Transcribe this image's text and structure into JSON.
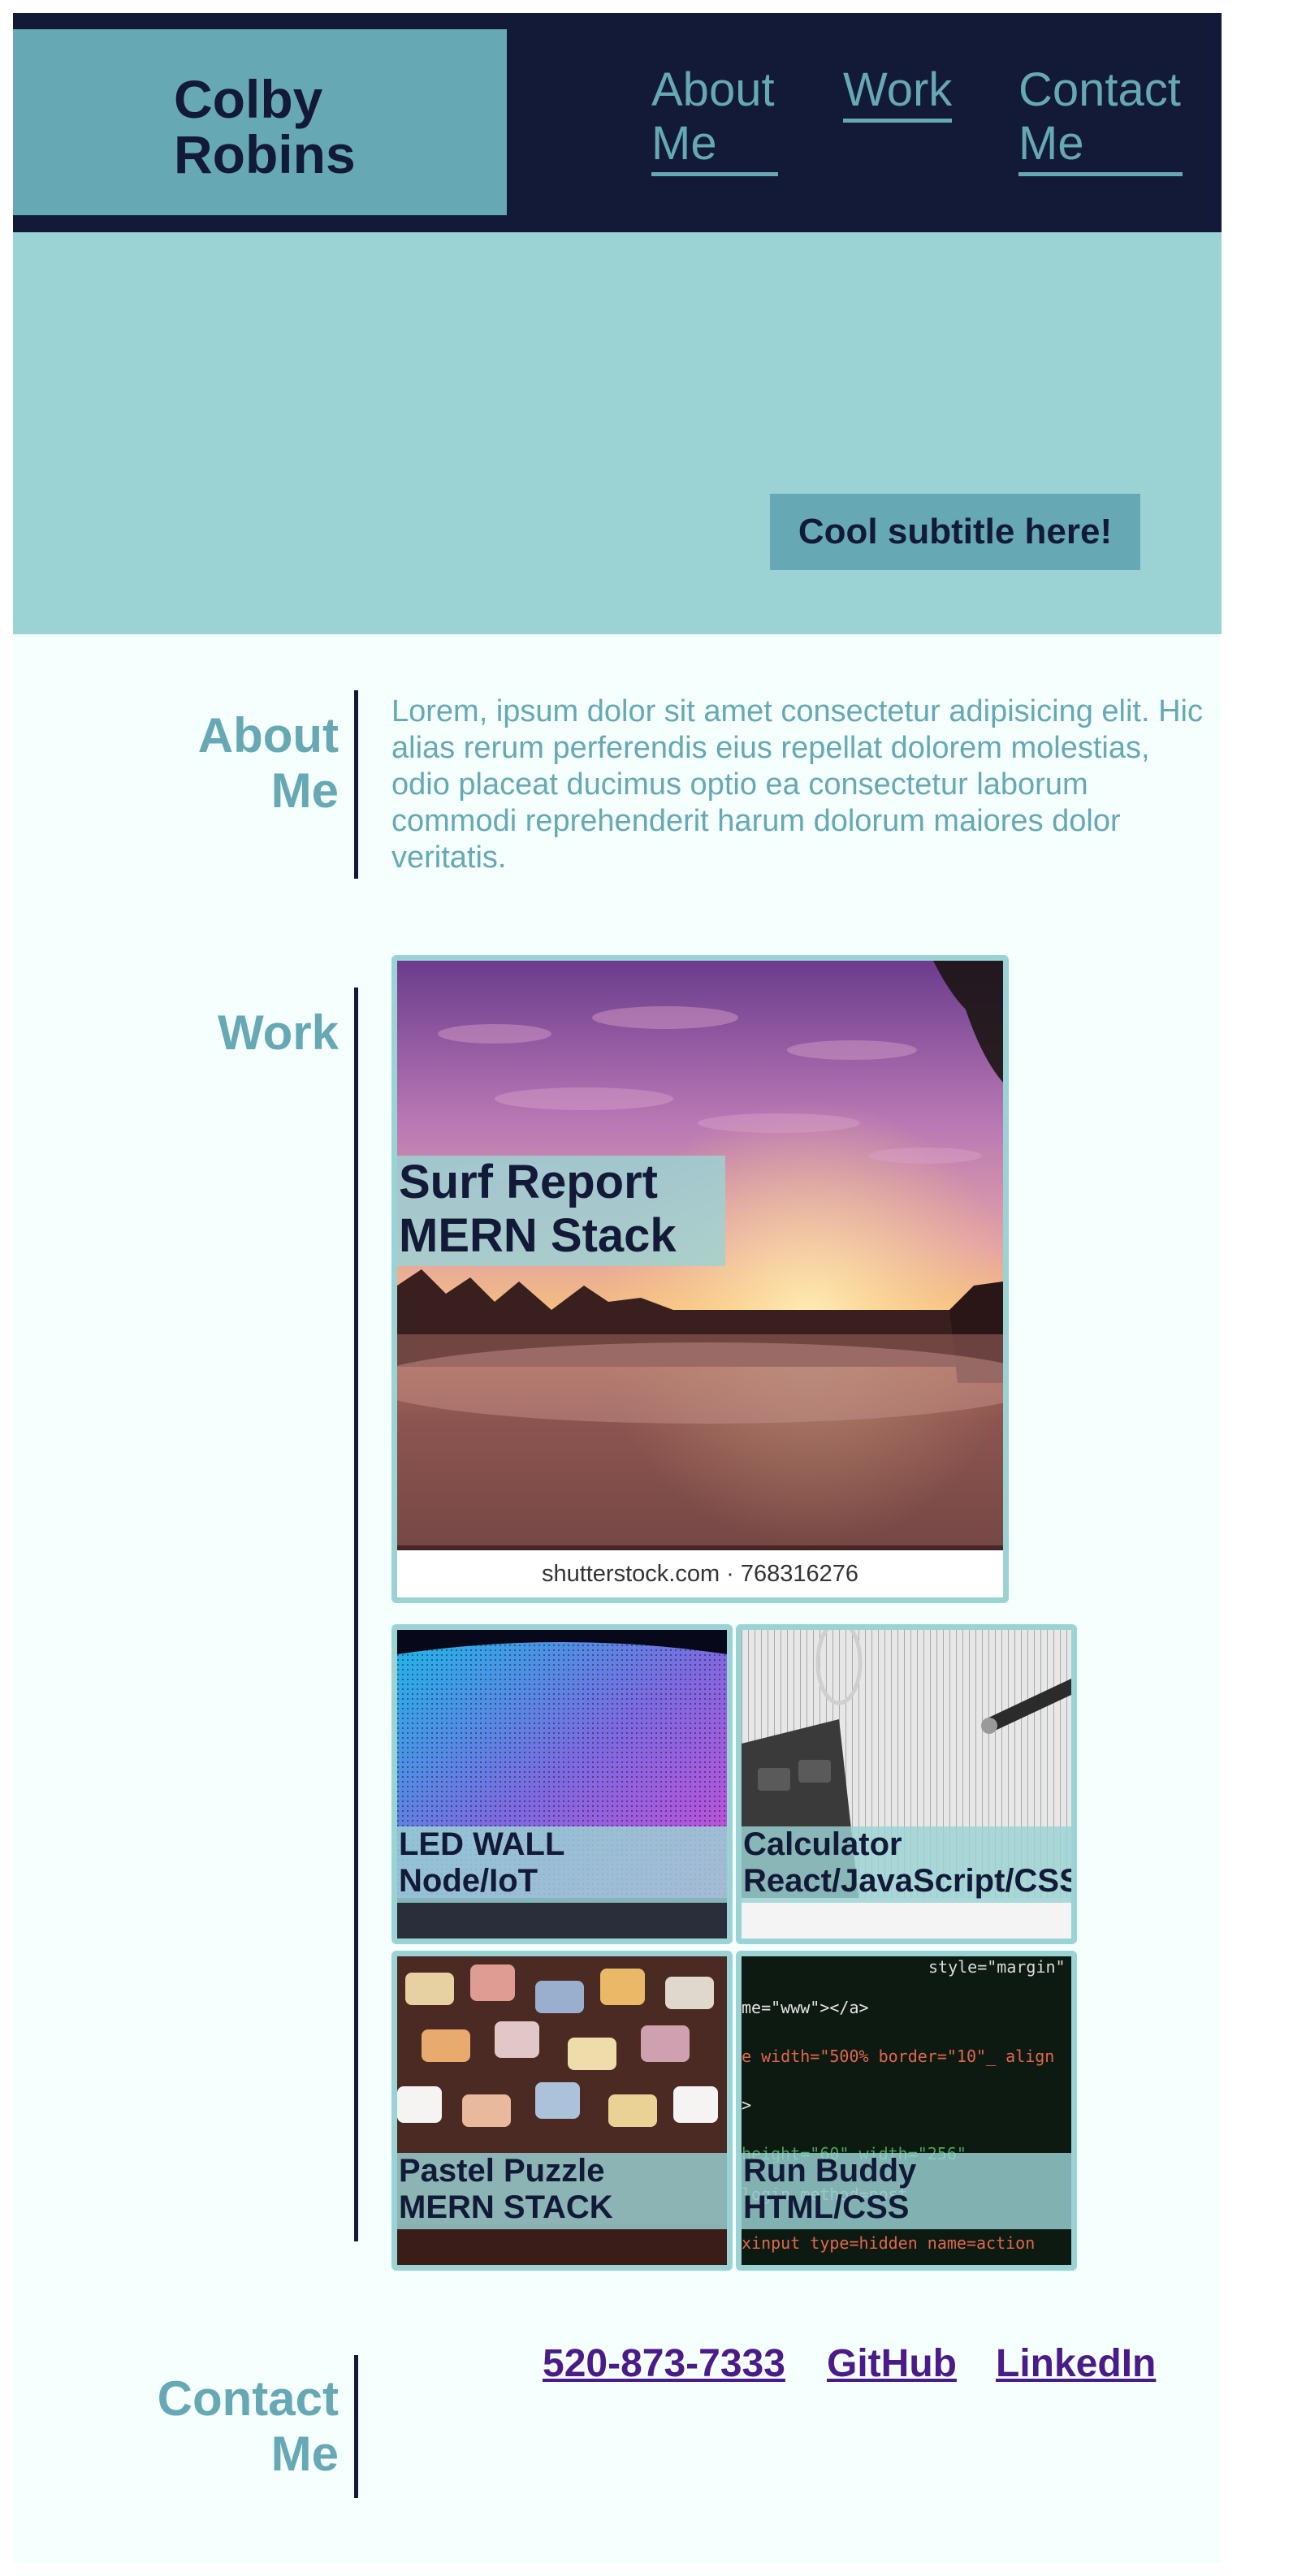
{
  "header": {
    "brand": "Colby Robins",
    "nav": [
      {
        "label": "About Me"
      },
      {
        "label": "Work"
      },
      {
        "label": "Contact Me"
      }
    ]
  },
  "hero": {
    "subtitle": "Cool subtitle here!"
  },
  "about": {
    "title": "About Me",
    "text": "Lorem, ipsum dolor sit amet consectetur adipisicing elit. Hic alias rerum perferendis eius repellat dolorem molestias, odio placeat ducimus optio ea consectetur laborum commodi reprehenderit harum dolorum maiores dolor veritatis."
  },
  "work": {
    "title": "Work",
    "featured": {
      "line1": "Surf Report",
      "line2": "MERN Stack",
      "image_caption": "shutterstock.com · 768316276"
    },
    "projects": [
      {
        "line1": "LED WALL",
        "line2": "Node/IoT",
        "image": "led-wall-image"
      },
      {
        "line1": "Calculator",
        "line2": "React/JavaScript/CSS",
        "image": "calculator-image"
      },
      {
        "line1": "Pastel Puzzle",
        "line2": "MERN STACK",
        "image": "puzzle-image"
      },
      {
        "line1": "Run Buddy",
        "line2": "HTML/CSS",
        "image": "code-image"
      }
    ]
  },
  "contact": {
    "title": "Contact Me",
    "links": [
      {
        "label": "520-873-7333"
      },
      {
        "label": "GitHub"
      },
      {
        "label": "LinkedIn"
      }
    ]
  },
  "colors": {
    "navy": "#121a38",
    "teal": "#66a8b3",
    "light_teal": "#9bd3d4",
    "background": "#f5fffe",
    "link": "#4b1c89"
  }
}
